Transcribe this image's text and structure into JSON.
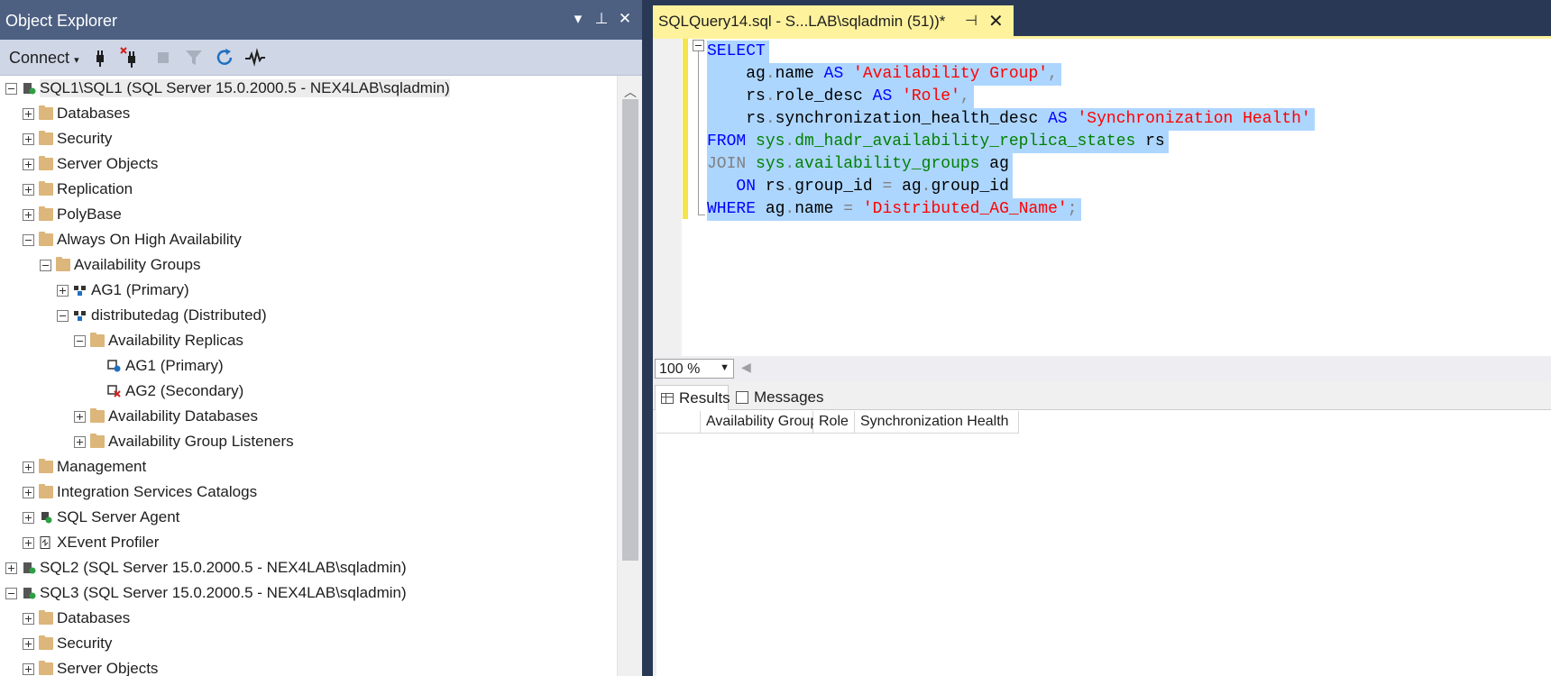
{
  "object_explorer": {
    "title": "Object Explorer",
    "toolbar": {
      "connect_label": "Connect"
    },
    "tree": [
      {
        "label": "SQL1\\SQL1 (SQL Server 15.0.2000.5 - NEX4LAB\\sqladmin)",
        "expander": "minus",
        "icon": "server-connected-icon"
      },
      {
        "label": "Databases",
        "expander": "plus",
        "icon": "folder-icon"
      },
      {
        "label": "Security",
        "expander": "plus",
        "icon": "folder-icon"
      },
      {
        "label": "Server Objects",
        "expander": "plus",
        "icon": "folder-icon"
      },
      {
        "label": "Replication",
        "expander": "plus",
        "icon": "folder-icon"
      },
      {
        "label": "PolyBase",
        "expander": "plus",
        "icon": "folder-icon"
      },
      {
        "label": "Always On High Availability",
        "expander": "minus",
        "icon": "folder-icon"
      },
      {
        "label": "Availability Groups",
        "expander": "minus",
        "icon": "folder-icon"
      },
      {
        "label": "AG1 (Primary)",
        "expander": "plus",
        "icon": "availability-group-icon"
      },
      {
        "label": "distributedag (Distributed)",
        "expander": "minus",
        "icon": "availability-group-icon"
      },
      {
        "label": "Availability Replicas",
        "expander": "minus",
        "icon": "folder-icon"
      },
      {
        "label": "AG1 (Primary)",
        "expander": "none",
        "icon": "replica-primary-icon"
      },
      {
        "label": "AG2 (Secondary)",
        "expander": "none",
        "icon": "replica-secondary-icon"
      },
      {
        "label": "Availability Databases",
        "expander": "plus",
        "icon": "folder-icon"
      },
      {
        "label": "Availability Group Listeners",
        "expander": "plus",
        "icon": "folder-icon"
      },
      {
        "label": "Management",
        "expander": "plus",
        "icon": "folder-icon"
      },
      {
        "label": "Integration Services Catalogs",
        "expander": "plus",
        "icon": "folder-icon"
      },
      {
        "label": "SQL Server Agent",
        "expander": "plus",
        "icon": "sql-agent-icon"
      },
      {
        "label": "XEvent Profiler",
        "expander": "plus",
        "icon": "xevent-profiler-icon"
      },
      {
        "label": "SQL2 (SQL Server 15.0.2000.5 - NEX4LAB\\sqladmin)",
        "expander": "plus",
        "icon": "server-connected-icon"
      },
      {
        "label": "SQL3 (SQL Server 15.0.2000.5 - NEX4LAB\\sqladmin)",
        "expander": "minus",
        "icon": "server-connected-icon"
      },
      {
        "label": "Databases",
        "expander": "plus",
        "icon": "folder-icon"
      },
      {
        "label": "Security",
        "expander": "plus",
        "icon": "folder-icon"
      },
      {
        "label": "Server Objects",
        "expander": "plus",
        "icon": "folder-icon"
      }
    ]
  },
  "document_tab": {
    "title": "SQLQuery14.sql - S...LAB\\sqladmin (51))*"
  },
  "editor": {
    "lines": [
      [
        {
          "t": "SELECT",
          "c": "kw"
        }
      ],
      [
        {
          "t": "    ag",
          "c": ""
        },
        {
          "t": ".",
          "c": "op"
        },
        {
          "t": "name ",
          "c": ""
        },
        {
          "t": "AS ",
          "c": "kw"
        },
        {
          "t": "'Availability Group'",
          "c": "str"
        },
        {
          "t": ",",
          "c": "op"
        }
      ],
      [
        {
          "t": "    rs",
          "c": ""
        },
        {
          "t": ".",
          "c": "op"
        },
        {
          "t": "role_desc ",
          "c": ""
        },
        {
          "t": "AS ",
          "c": "kw"
        },
        {
          "t": "'Role'",
          "c": "str"
        },
        {
          "t": ",",
          "c": "op"
        }
      ],
      [
        {
          "t": "    rs",
          "c": ""
        },
        {
          "t": ".",
          "c": "op"
        },
        {
          "t": "synchronization_health_desc ",
          "c": ""
        },
        {
          "t": "AS ",
          "c": "kw"
        },
        {
          "t": "'Synchronization Health'",
          "c": "str"
        }
      ],
      [
        {
          "t": "FROM ",
          "c": "kw"
        },
        {
          "t": "sys",
          "c": "sys"
        },
        {
          "t": ".",
          "c": "op"
        },
        {
          "t": "dm_hadr_availability_replica_states ",
          "c": "sys"
        },
        {
          "t": "rs",
          "c": ""
        }
      ],
      [
        {
          "t": "JOIN ",
          "c": "gray"
        },
        {
          "t": "sys",
          "c": "sys"
        },
        {
          "t": ".",
          "c": "op"
        },
        {
          "t": "availability_groups ",
          "c": "sys"
        },
        {
          "t": "ag",
          "c": ""
        }
      ],
      [
        {
          "t": "   ON ",
          "c": "kw"
        },
        {
          "t": "rs",
          "c": ""
        },
        {
          "t": ".",
          "c": "op"
        },
        {
          "t": "group_id ",
          "c": ""
        },
        {
          "t": "= ",
          "c": "op"
        },
        {
          "t": "ag",
          "c": ""
        },
        {
          "t": ".",
          "c": "op"
        },
        {
          "t": "group_id",
          "c": ""
        }
      ],
      [
        {
          "t": "WHERE ",
          "c": "kw"
        },
        {
          "t": "ag",
          "c": ""
        },
        {
          "t": ".",
          "c": "op"
        },
        {
          "t": "name ",
          "c": ""
        },
        {
          "t": "= ",
          "c": "op"
        },
        {
          "t": "'Distributed_AG_Name'",
          "c": "str"
        },
        {
          "t": ";",
          "c": "op"
        }
      ]
    ]
  },
  "zoom": {
    "value": "100 %"
  },
  "results": {
    "tabs": [
      {
        "label": "Results",
        "active": true
      },
      {
        "label": "Messages",
        "active": false
      }
    ],
    "columns": [
      "Availability Group",
      "Role",
      "Synchronization Health"
    ]
  },
  "colors": {
    "title_bar": "#4d6082",
    "tab_yellow": "#fff29d",
    "selection": "#add6ff",
    "keyword": "#0000ff",
    "string": "#ff0000",
    "system_object": "#008000"
  }
}
